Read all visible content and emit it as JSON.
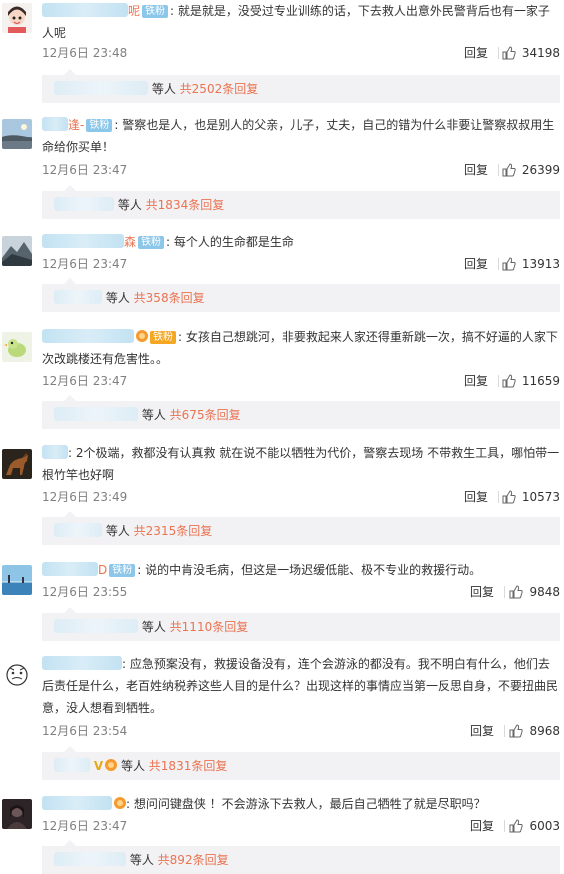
{
  "ui": {
    "reply_label": "回复",
    "more_suffix": "等人",
    "badge_label": "铁粉"
  },
  "comments": [
    {
      "avatar": "girl-face-avatar",
      "lines": [
        ": 就是就是，没受过专业训练的话，下去救人出意外民警背后也有一家子",
        "人呢"
      ],
      "suffix_char": "呢",
      "time": "12月6日 23:48",
      "likes": "34198",
      "replies_text": "共2502条回复"
    },
    {
      "avatar": "landscape-avatar",
      "lines": [
        ": 警察也是人，也是别人的父亲，儿子，丈夫，自己的错为什么非要让警察叔叔用生",
        "命给你买单！"
      ],
      "suffix_char": "逢-",
      "time": "12月6日 23:47",
      "likes": "26399",
      "replies_text": "共1834条回复"
    },
    {
      "avatar": "mountain-avatar",
      "lines": [
        ": 每个人的生命都是生命"
      ],
      "suffix_char": "森",
      "time": "12月6日 23:47",
      "likes": "13913",
      "replies_text": "共358条回复"
    },
    {
      "avatar": "bird-avatar",
      "lines": [
        ": 女孩自己想跳河，非要救起来人家还得重新跳一次，搞不好逼的人家下",
        "次改跳楼还有危害性。。"
      ],
      "time": "12月6日 23:47",
      "likes": "11659",
      "replies_text": "共675条回复"
    },
    {
      "avatar": "horse-avatar",
      "lines": [
        ": 2个极端，救都没有认真救 就在说不能以牺牲为代价，警察去现场 不带救生工具，哪怕带一",
        "根竹竿也好啊"
      ],
      "time": "12月6日 23:49",
      "likes": "10573",
      "replies_text": "共2315条回复"
    },
    {
      "avatar": "sea-avatar",
      "lines": [
        ": 说的中肯没毛病，但这是一场迟缓低能、极不专业的救援行动。"
      ],
      "suffix_char": "D",
      "time": "12月6日 23:55",
      "likes": "9848",
      "replies_text": "共1110条回复"
    },
    {
      "avatar": "cartoon-avatar",
      "lines": [
        ": 应急预案没有，救援设备没有，连个会游泳的都没有。我不明白有什么，他们去",
        "后责任是什么，老百姓纳税养这些人目的是什么？出现这样的事情应当第一反思自身，不要扭曲民",
        "意，没人想看到牺牲。"
      ],
      "time": "12月6日 23:54",
      "likes": "8968",
      "replies_text": "共1831条回复"
    },
    {
      "avatar": "dark-photo-avatar",
      "lines": [
        ": 想问问键盘侠 ！不会游泳下去救人，最后自己牺牲了就是尽职吗？"
      ],
      "time": "12月6日 23:47",
      "likes": "6003",
      "replies_text": "共892条回复"
    }
  ]
}
